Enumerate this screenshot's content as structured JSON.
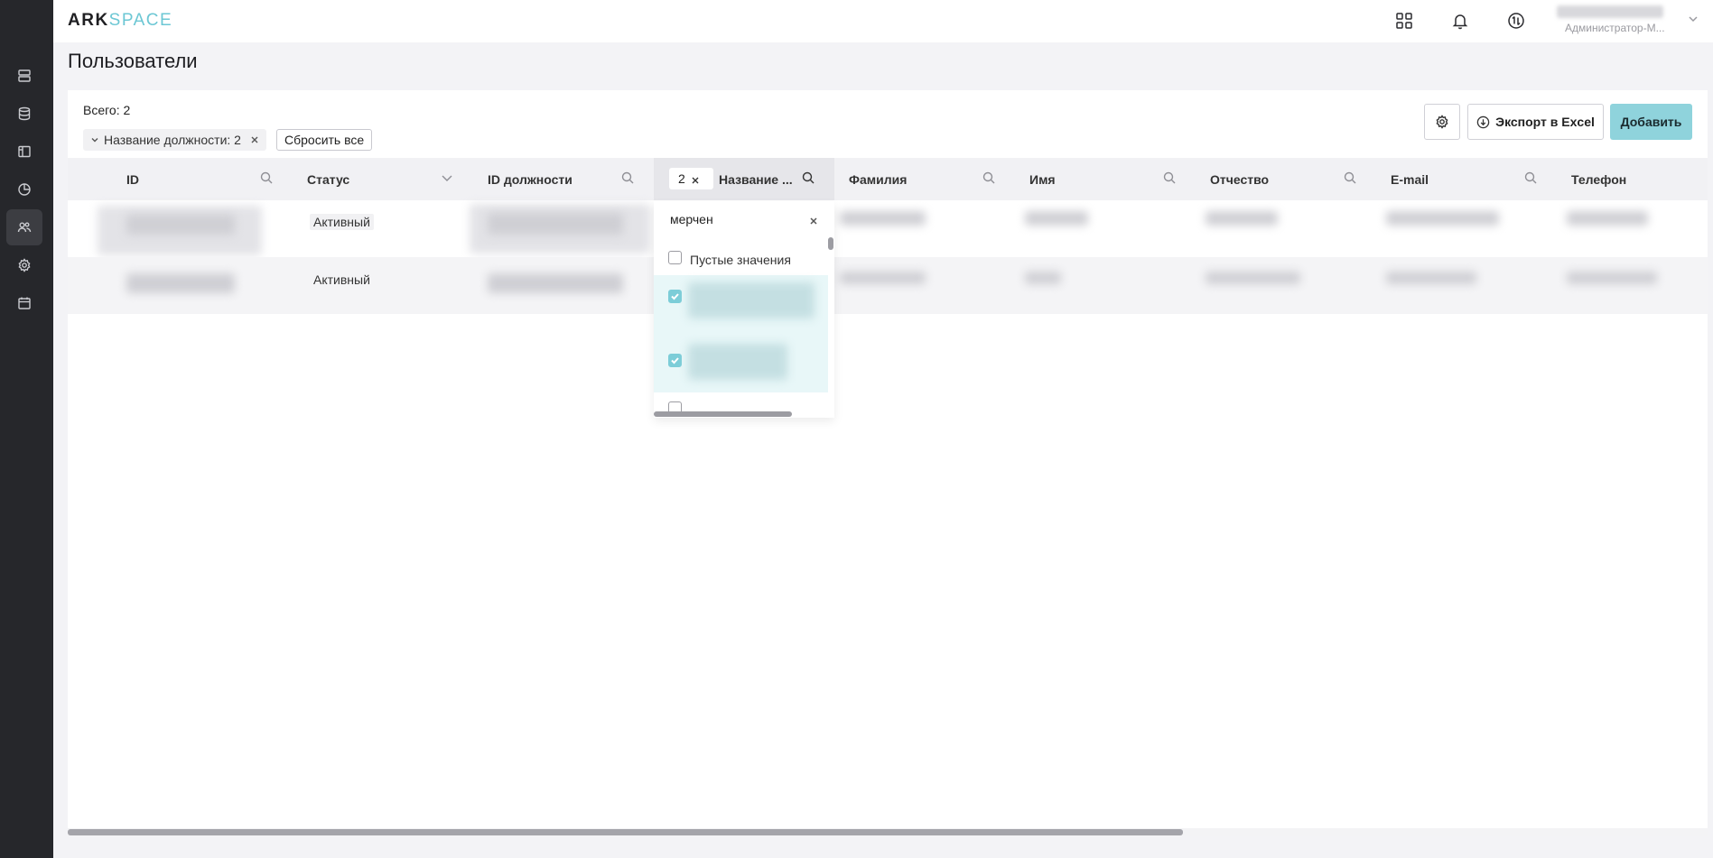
{
  "header": {
    "logo_ark": "ARK",
    "logo_space": "SPACE",
    "user_role": "Администратор-М..."
  },
  "page": {
    "title": "Пользователи",
    "total": "Всего: 2"
  },
  "filters": {
    "chip_label": "Название должности: 2",
    "reset_label": "Сбросить все"
  },
  "toolbar": {
    "export_label": "Экспорт в Excel",
    "add_label": "Добавить"
  },
  "table": {
    "columns": [
      "ID",
      "Статус",
      "ID должности",
      "Название ...",
      "Фамилия",
      "Имя",
      "Отчество",
      "E-mail",
      "Телефон"
    ],
    "active_filter_count": "2",
    "rows": [
      {
        "status": "Активный"
      },
      {
        "status": "Активный"
      }
    ]
  },
  "dropdown": {
    "search_value": "мерчен",
    "empty_option": "Пустые значения",
    "options": [
      {
        "checked": false,
        "label": "Пустые значения"
      },
      {
        "checked": true
      },
      {
        "checked": true
      },
      {
        "checked": false
      }
    ]
  },
  "colors": {
    "sidebar_bg": "#26272b",
    "accent": "#8fd3dc",
    "checkbox_checked": "#7ccdd8"
  },
  "icons": {
    "sidebar": [
      "server-icon",
      "database-icon",
      "layout-icon",
      "chart-pie-icon",
      "users-icon",
      "gear-icon",
      "calendar-icon"
    ],
    "header": [
      "apps-grid-icon",
      "bell-icon",
      "sync-icon",
      "chevron-down-icon"
    ]
  }
}
